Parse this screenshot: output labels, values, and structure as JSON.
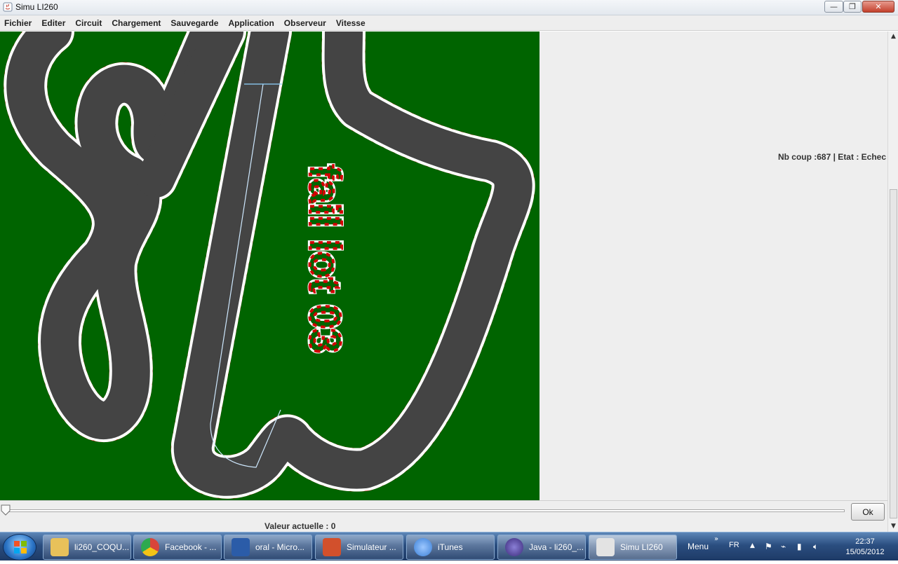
{
  "window": {
    "title": "Simu LI260",
    "minimize_glyph": "—",
    "maximize_glyph": "❐",
    "close_glyph": "✕"
  },
  "menu": {
    "items": [
      "Fichier",
      "Editer",
      "Circuit",
      "Chargement",
      "Sauvegarde",
      "Application",
      "Observeur",
      "Vitesse"
    ]
  },
  "track": {
    "text": "fail lot 03",
    "track_color": "#444444",
    "grass_color": "#006400",
    "border_color_a": "#d10000",
    "border_color_b": "#ffffff"
  },
  "side_panel": {
    "status": "Nb coup :687 | Etat : Echec"
  },
  "bottom": {
    "slider_value": 0,
    "current_value_label": "Valeur actuelle : 0",
    "ok_label": "Ok"
  },
  "taskbar": {
    "items": [
      {
        "label": "li260_COQU...",
        "icon": "folder-icon",
        "color": "#e8c15a"
      },
      {
        "label": "Facebook - ...",
        "icon": "chrome-icon",
        "color": "#d9453a"
      },
      {
        "label": "oral - Micro...",
        "icon": "word-icon",
        "color": "#2b5ca8"
      },
      {
        "label": "Simulateur ...",
        "icon": "powerpoint-icon",
        "color": "#d2502c"
      },
      {
        "label": "iTunes",
        "icon": "itunes-icon",
        "color": "#3b7fd6"
      },
      {
        "label": "Java - li260_...",
        "icon": "eclipse-icon",
        "color": "#3b2a7a"
      },
      {
        "label": "Simu LI260",
        "icon": "java-icon",
        "color": "#e3e3e3"
      }
    ],
    "tray_menu_label": "Menu",
    "language": "FR",
    "time": "22:37",
    "date": "15/05/2012"
  }
}
